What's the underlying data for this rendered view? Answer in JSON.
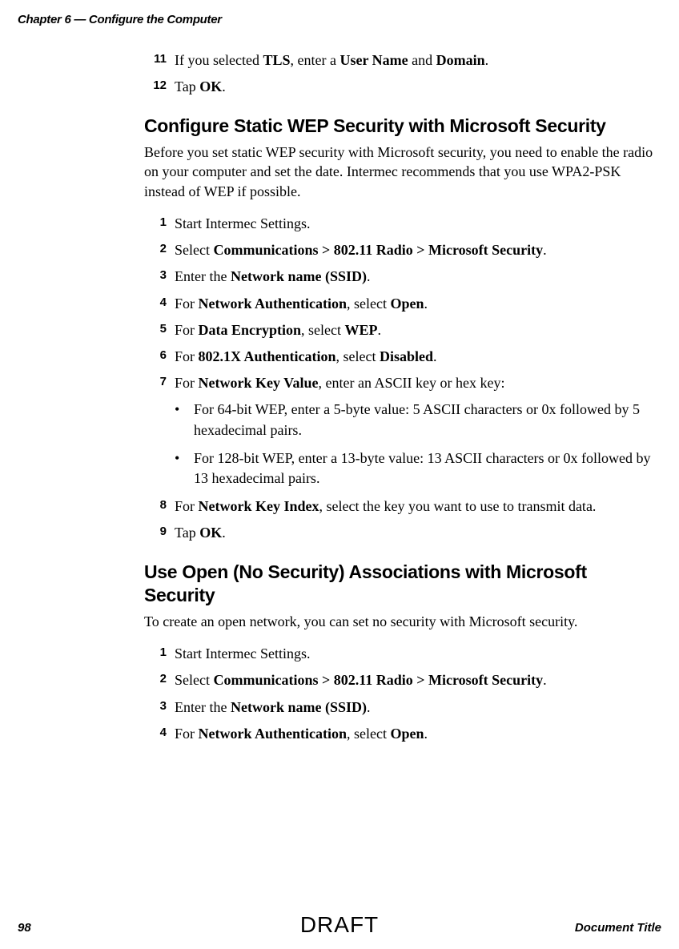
{
  "header": "Chapter 6 — Configure the Computer",
  "steps_a": [
    {
      "num": "11",
      "segments": [
        "If you selected ",
        {
          "b": "TLS"
        },
        ", enter a ",
        {
          "b": "User Name"
        },
        " and ",
        {
          "b": "Domain"
        },
        "."
      ]
    },
    {
      "num": "12",
      "segments": [
        "Tap ",
        {
          "b": "OK"
        },
        "."
      ]
    }
  ],
  "section1": {
    "heading": "Configure Static WEP Security with Microsoft Security",
    "intro": "Before you set static WEP security with Microsoft security, you need to enable the radio on your computer and set the date. Intermec recommends that you use WPA2-PSK instead of WEP if possible.",
    "steps": [
      {
        "num": "1",
        "segments": [
          "Start Intermec Settings."
        ]
      },
      {
        "num": "2",
        "segments": [
          "Select ",
          {
            "b": "Communications > 802.11 Radio > Microsoft Security"
          },
          "."
        ]
      },
      {
        "num": "3",
        "segments": [
          "Enter the ",
          {
            "b": "Network name (SSID)"
          },
          "."
        ]
      },
      {
        "num": "4",
        "segments": [
          "For ",
          {
            "b": "Network Authentication"
          },
          ", select ",
          {
            "b": "Open"
          },
          "."
        ]
      },
      {
        "num": "5",
        "segments": [
          "For ",
          {
            "b": "Data Encryption"
          },
          ", select ",
          {
            "b": "WEP"
          },
          "."
        ]
      },
      {
        "num": "6",
        "segments": [
          "For ",
          {
            "b": "802.1X Authentication"
          },
          ", select ",
          {
            "b": "Disabled"
          },
          "."
        ]
      },
      {
        "num": "7",
        "segments": [
          "For ",
          {
            "b": "Network Key Value"
          },
          ", enter an ASCII key or hex key:"
        ]
      }
    ],
    "bullets": [
      "For 64-bit WEP, enter a 5-byte value: 5 ASCII characters or 0x followed by 5 hexadecimal pairs.",
      "For 128-bit WEP, enter a 13-byte value: 13 ASCII characters or 0x followed by 13 hexadecimal pairs."
    ],
    "steps_b": [
      {
        "num": "8",
        "segments": [
          "For ",
          {
            "b": "Network Key Index"
          },
          ", select the key you want to use to transmit data."
        ]
      },
      {
        "num": "9",
        "segments": [
          "Tap ",
          {
            "b": "OK"
          },
          "."
        ]
      }
    ]
  },
  "section2": {
    "heading": "Use Open (No Security) Associations with Microsoft Security",
    "intro": "To create an open network, you can set no security with Microsoft security.",
    "steps": [
      {
        "num": "1",
        "segments": [
          "Start Intermec Settings."
        ]
      },
      {
        "num": "2",
        "segments": [
          "Select ",
          {
            "b": "Communications > 802.11 Radio > Microsoft Security"
          },
          "."
        ]
      },
      {
        "num": "3",
        "segments": [
          "Enter the ",
          {
            "b": "Network name (SSID)"
          },
          "."
        ]
      },
      {
        "num": "4",
        "segments": [
          "For ",
          {
            "b": "Network Authentication"
          },
          ", select ",
          {
            "b": "Open"
          },
          "."
        ]
      }
    ]
  },
  "footer": {
    "page_num": "98",
    "doc_title": "Document Title",
    "watermark": "DRAFT"
  }
}
